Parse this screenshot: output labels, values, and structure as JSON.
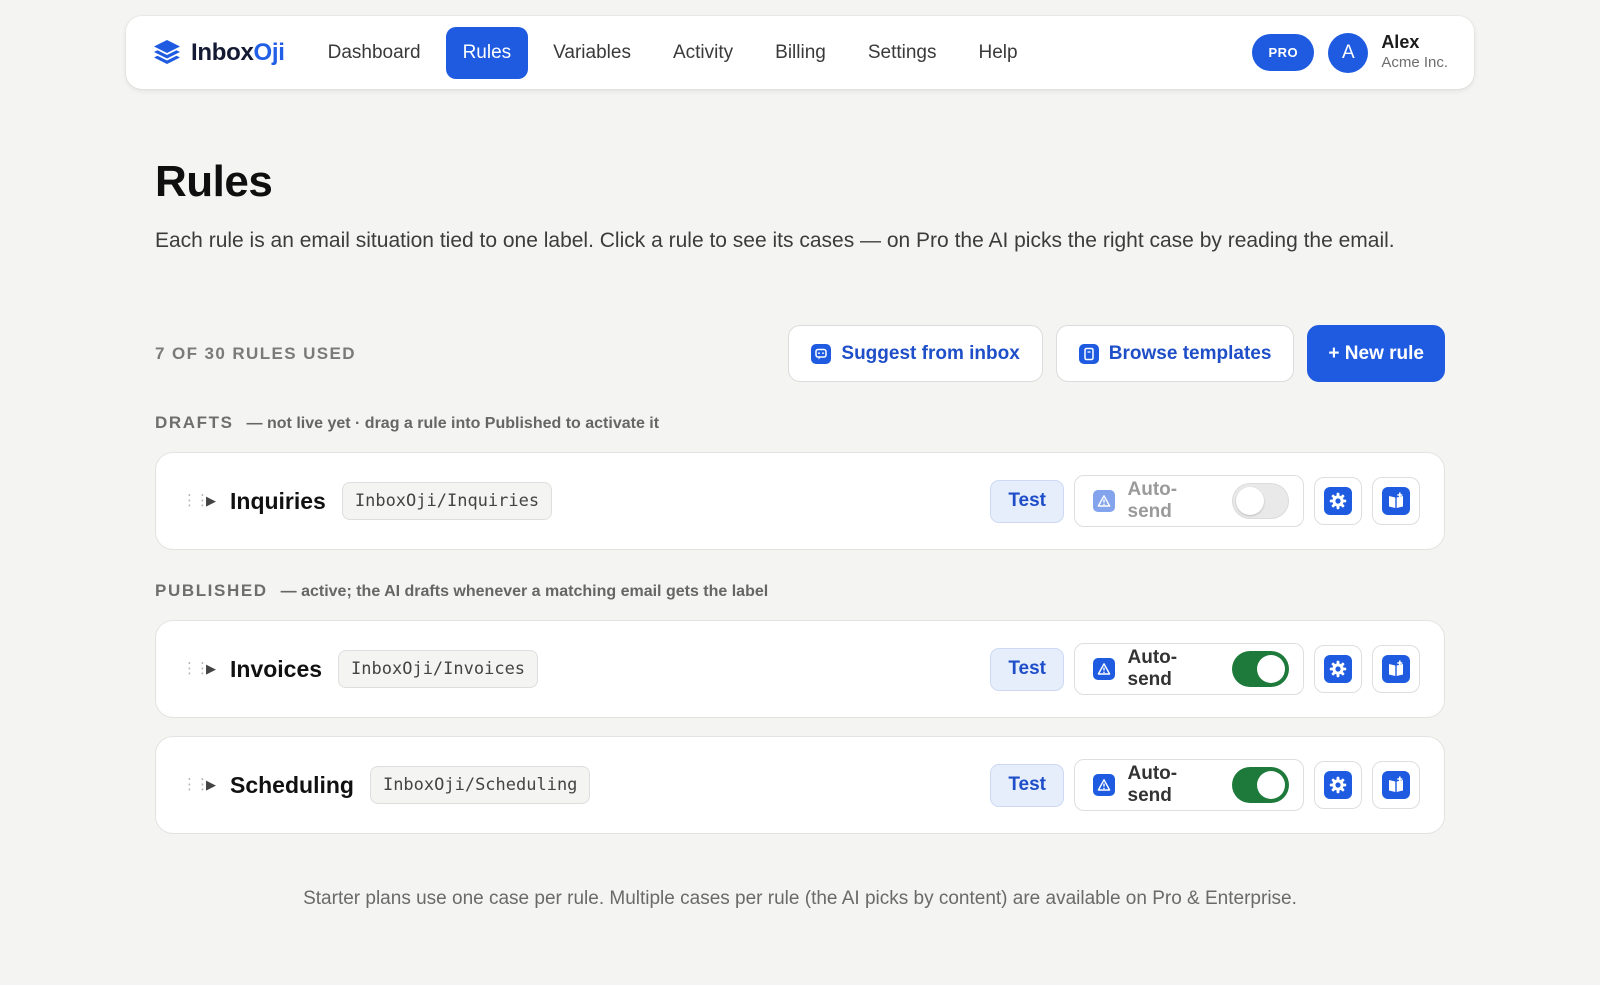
{
  "nav": {
    "brand": {
      "part1": "Inbox",
      "part2": "Oji"
    },
    "links": [
      {
        "label": "Dashboard",
        "active": false
      },
      {
        "label": "Rules",
        "active": true
      },
      {
        "label": "Variables",
        "active": false
      },
      {
        "label": "Activity",
        "active": false
      },
      {
        "label": "Billing",
        "active": false
      },
      {
        "label": "Settings",
        "active": false
      },
      {
        "label": "Help",
        "active": false
      }
    ],
    "plan_badge": "PRO",
    "user": {
      "initial": "A",
      "name": "Alex",
      "org": "Acme Inc."
    }
  },
  "header": {
    "title": "Rules",
    "description": "Each rule is an email situation tied to one label. Click a rule to see its cases — on Pro the AI picks the right case by reading the email."
  },
  "toolbar": {
    "usage": "7 OF 30 RULES USED",
    "suggest_label": "Suggest from inbox",
    "templates_label": "Browse templates",
    "new_rule_label": "+ New rule"
  },
  "sections": {
    "drafts": {
      "name": "DRAFTS",
      "note": "— not live yet · drag a rule into Published to activate it"
    },
    "published": {
      "name": "PUBLISHED",
      "note": "— active; the AI drafts whenever a matching email gets the label"
    }
  },
  "rules": [
    {
      "name": "Inquiries",
      "label": "InboxOji/Inquiries",
      "test": "Test",
      "autosend_label": "Auto-send",
      "autosend_on": false
    },
    {
      "name": "Invoices",
      "label": "InboxOji/Invoices",
      "test": "Test",
      "autosend_label": "Auto-send",
      "autosend_on": true
    },
    {
      "name": "Scheduling",
      "label": "InboxOji/Scheduling",
      "test": "Test",
      "autosend_label": "Auto-send",
      "autosend_on": true
    }
  ],
  "footer": {
    "note": "Starter plans use one case per rule. Multiple cases per rule (the AI picks by content) are available on Pro & Enterprise."
  },
  "colors": {
    "accent": "#1e5be0",
    "toggle_on": "#1d7a3a",
    "background": "#f4f4f2"
  },
  "icons": [
    "stack-logo-icon",
    "chat-bubble-icon",
    "template-doc-icon",
    "drag-handle-icon",
    "caret-right-icon",
    "warning-triangle-icon",
    "gear-icon",
    "book-plus-icon"
  ]
}
